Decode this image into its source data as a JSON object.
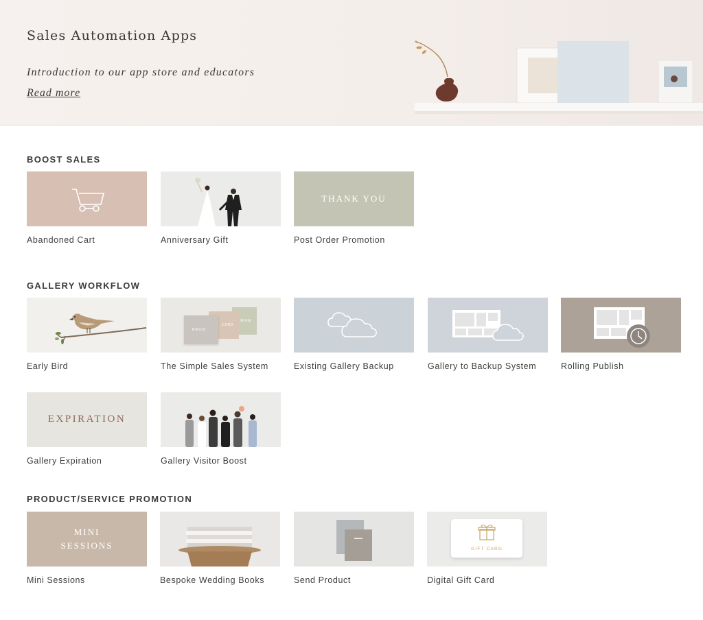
{
  "hero": {
    "title": "Sales Automation Apps",
    "subtitle": "Introduction to our app store and educators",
    "link": "Read more"
  },
  "sections": [
    {
      "title": "BOOST SALES",
      "items": [
        {
          "label": "Abandoned Cart",
          "icon": "shopping-cart-icon",
          "bg": "#d8bfb4"
        },
        {
          "label": "Anniversary Gift",
          "icon": "wedding-couple-illustration",
          "bg": "#ebebea"
        },
        {
          "label": "Post Order Promotion",
          "thumb_text": "THANK YOU",
          "bg": "#c3c4b4"
        }
      ]
    },
    {
      "title": "GALLERY WORKFLOW",
      "items": [
        {
          "label": "Early Bird",
          "icon": "bird-on-branch-illustration",
          "bg": "#f1f0ec"
        },
        {
          "label": "The Simple Sales System",
          "icon": "stacked-cards-icon",
          "bg": "#ebe9e6",
          "card_texts": [
            "BASIC",
            "CARD",
            "MIUM"
          ]
        },
        {
          "label": "Existing Gallery Backup",
          "icon": "cloud-icon",
          "bg": "#ccd3d8"
        },
        {
          "label": "Gallery to Backup System",
          "icon": "gallery-cloud-icon",
          "bg": "#cfd4db"
        },
        {
          "label": "Rolling Publish",
          "icon": "gallery-clock-icon",
          "bg": "#aca297"
        },
        {
          "label": "Gallery Expiration",
          "thumb_text": "EXPIRATION",
          "bg": "#e7e5e0",
          "thumb_text_color": "#8a6a5a"
        },
        {
          "label": "Gallery Visitor Boost",
          "icon": "people-group-illustration",
          "bg": "#ebebea"
        }
      ]
    },
    {
      "title": "PRODUCT/SERVICE PROMOTION",
      "items": [
        {
          "label": "Mini Sessions",
          "thumb_text": "MINI\nSESSIONS",
          "bg": "#c8b8a9"
        },
        {
          "label": "Bespoke Wedding Books",
          "icon": "books-on-table-photo",
          "bg": "#eae8e6"
        },
        {
          "label": "Send Product",
          "icon": "product-boxes-icon",
          "bg": "#e5e5e4"
        },
        {
          "label": "Digital Gift Card",
          "icon": "gift-icon",
          "bg": "#ebebea",
          "card_text": "GIFT CARD"
        }
      ]
    }
  ]
}
